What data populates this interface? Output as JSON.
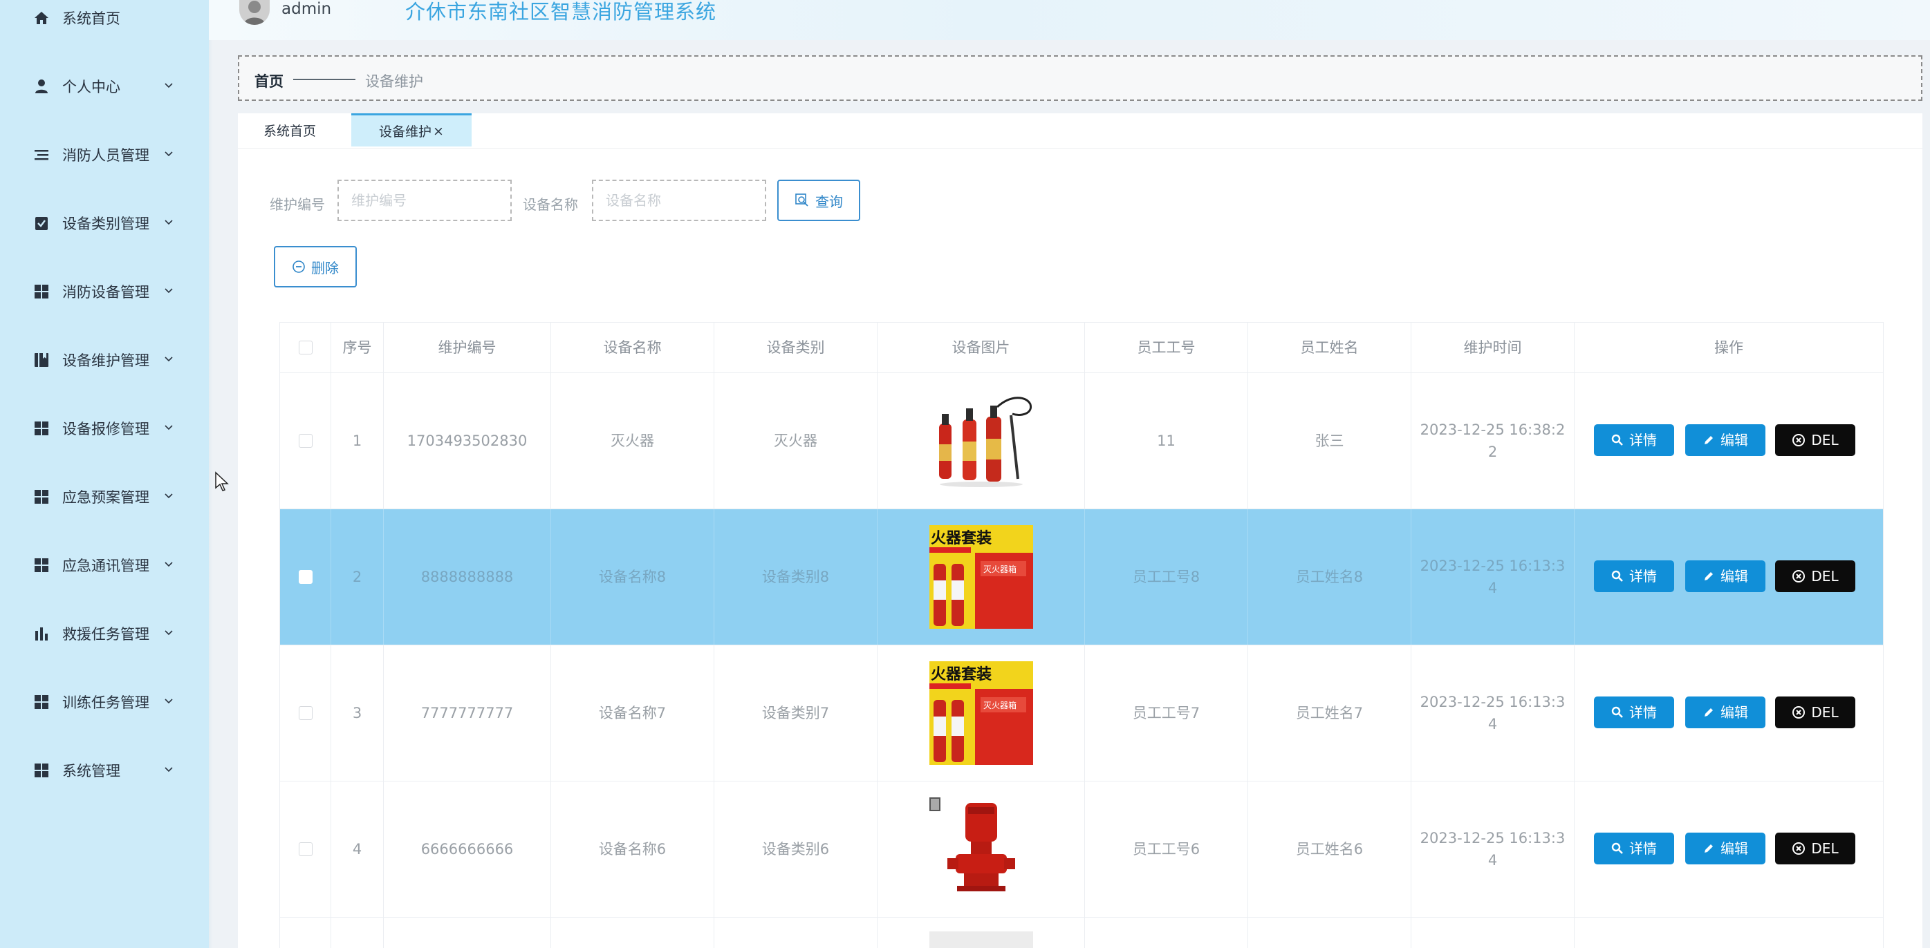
{
  "header": {
    "username": "admin",
    "system_title": "介休市东南社区智慧消防管理系统"
  },
  "sidebar": {
    "items": [
      {
        "label": "系统首页",
        "icon": "home-icon"
      },
      {
        "label": "个人中心",
        "icon": "user-icon"
      },
      {
        "label": "消防人员管理",
        "icon": "list-icon"
      },
      {
        "label": "设备类别管理",
        "icon": "clipboard-check-icon"
      },
      {
        "label": "消防设备管理",
        "icon": "grid-icon"
      },
      {
        "label": "设备维护管理",
        "icon": "book-icon"
      },
      {
        "label": "设备报修管理",
        "icon": "grid-icon"
      },
      {
        "label": "应急预案管理",
        "icon": "grid-icon"
      },
      {
        "label": "应急通讯管理",
        "icon": "grid-icon"
      },
      {
        "label": "救援任务管理",
        "icon": "bar-chart-icon"
      },
      {
        "label": "训练任务管理",
        "icon": "grid-icon"
      },
      {
        "label": "系统管理",
        "icon": "grid-icon"
      }
    ]
  },
  "breadcrumb": {
    "home": "首页",
    "current": "设备维护"
  },
  "tabs": [
    {
      "label": "系统首页"
    },
    {
      "label": "设备维护",
      "close": "×"
    }
  ],
  "search": {
    "field1_label": "维护编号",
    "field1_placeholder": "维护编号",
    "field2_label": "设备名称",
    "field2_placeholder": "设备名称",
    "query_button": "查询"
  },
  "toolbar": {
    "delete_button": "删除"
  },
  "table": {
    "columns": [
      "序号",
      "维护编号",
      "设备名称",
      "设备类别",
      "设备图片",
      "员工工号",
      "员工姓名",
      "维护时间",
      "操作"
    ],
    "rows": [
      {
        "index": "1",
        "code": "1703493502830",
        "name": "灭火器",
        "category": "灭火器",
        "image": "co2-extinguishers",
        "staff_no": "11",
        "staff_name": "张三",
        "time_line1": "2023-12-25 16:38:2",
        "time_line2": "2"
      },
      {
        "index": "2",
        "code": "8888888888",
        "name": "设备名称8",
        "category": "设备类别8",
        "image": "extinguisher-box",
        "image_text": "火器套装",
        "box_text": "灭火器箱",
        "staff_no": "员工工号8",
        "staff_name": "员工姓名8",
        "time_line1": "2023-12-25 16:13:3",
        "time_line2": "4"
      },
      {
        "index": "3",
        "code": "7777777777",
        "name": "设备名称7",
        "category": "设备类别7",
        "image": "extinguisher-box",
        "image_text": "火器套装",
        "box_text": "灭火器箱",
        "staff_no": "员工工号7",
        "staff_name": "员工姓名7",
        "time_line1": "2023-12-25 16:13:3",
        "time_line2": "4"
      },
      {
        "index": "4",
        "code": "6666666666",
        "name": "设备名称6",
        "category": "设备类别6",
        "image": "fire-pump",
        "staff_no": "员工工号6",
        "staff_name": "员工姓名6",
        "time_line1": "2023-12-25 16:13:3",
        "time_line2": "4"
      }
    ],
    "actions": {
      "detail": "详情",
      "edit": "编辑",
      "del": "DEL"
    },
    "selected_row": 2
  },
  "colors": {
    "sidebar_bg": "#cdebf9",
    "accent": "#118fd8",
    "selected_row": "#8fd0f2",
    "title": "#3aa5e0"
  }
}
